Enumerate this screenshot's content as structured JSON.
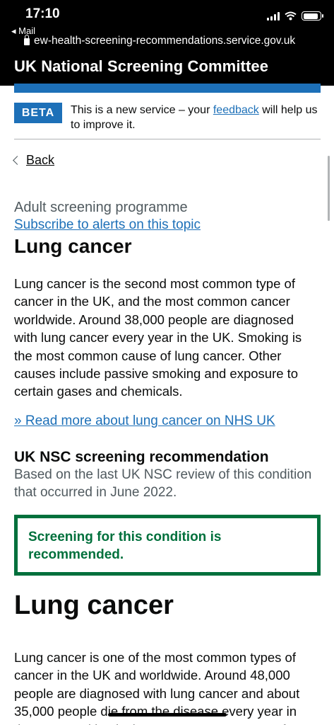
{
  "status_bar": {
    "time": "17:10",
    "back_app": "◂ Mail",
    "url": "ew-health-screening-recommendations.service.gov.uk"
  },
  "header": {
    "service_name": "UK National Screening Committee"
  },
  "phase_banner": {
    "tag": "BETA",
    "text_before": "This is a new service – your ",
    "link": "feedback",
    "text_after": " will help us to improve it."
  },
  "nav": {
    "back_label": "Back"
  },
  "page": {
    "caption": "Adult screening programme",
    "subscribe_link": "Subscribe to alerts on this topic",
    "title": "Lung cancer",
    "intro": "Lung cancer is the second most common type of cancer in the UK, and the most common cancer worldwide. Around 38,000 people are diagnosed with lung cancer every year in the UK. Smoking is the most common cause of lung cancer. Other causes include passive smoking and exposure to certain gases and chemicals.",
    "read_more_link": "» Read more about lung cancer on NHS UK"
  },
  "recommendation": {
    "heading": "UK NSC screening recommendation",
    "review_text": "Based on the last UK NSC review of this condition that occurred in June 2022.",
    "status": "Screening for this condition is recommended."
  },
  "condition": {
    "title": "Lung cancer",
    "description": "Lung cancer is one of the most common types of cancer in the UK and worldwide. Around 48,000 people are diagnosed with lung cancer and about 35,000 people die from the disease every year in the UK. Smoking is the most common cause of"
  },
  "colors": {
    "brand_blue": "#1d70b8",
    "recommended_green": "#00703c",
    "text": "#0b0c0c",
    "secondary_text": "#505a5f"
  }
}
